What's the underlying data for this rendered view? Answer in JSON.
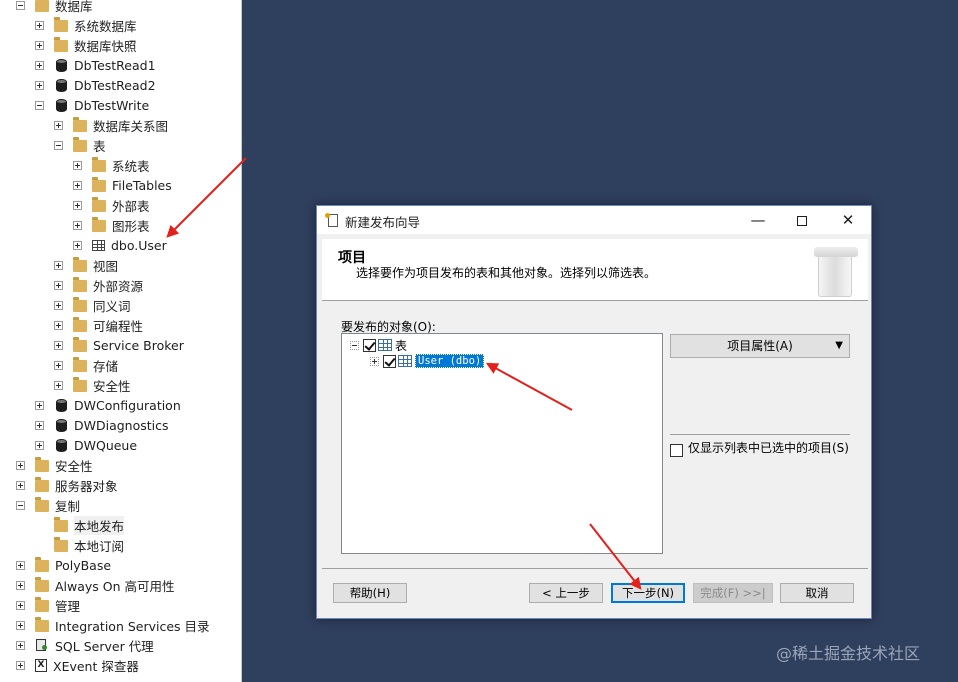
{
  "object_explorer": {
    "items": [
      {
        "label": "数据库",
        "icon": "folder-icon",
        "expander": "minus",
        "level": 0
      },
      {
        "label": "系统数据库",
        "icon": "folder-icon",
        "expander": "plus",
        "level": 1
      },
      {
        "label": "数据库快照",
        "icon": "folder-icon",
        "expander": "plus",
        "level": 1
      },
      {
        "label": "DbTestRead1",
        "icon": "database-icon",
        "expander": "plus",
        "level": 1
      },
      {
        "label": "DbTestRead2",
        "icon": "database-icon",
        "expander": "plus",
        "level": 1
      },
      {
        "label": "DbTestWrite",
        "icon": "database-icon",
        "expander": "minus",
        "level": 1
      },
      {
        "label": "数据库关系图",
        "icon": "folder-icon",
        "expander": "plus",
        "level": 2
      },
      {
        "label": "表",
        "icon": "folder-icon",
        "expander": "minus",
        "level": 2
      },
      {
        "label": "系统表",
        "icon": "folder-icon",
        "expander": "plus",
        "level": 3
      },
      {
        "label": "FileTables",
        "icon": "folder-icon",
        "expander": "plus",
        "level": 3
      },
      {
        "label": "外部表",
        "icon": "folder-icon",
        "expander": "plus",
        "level": 3
      },
      {
        "label": "图形表",
        "icon": "folder-icon",
        "expander": "plus",
        "level": 3
      },
      {
        "label": "dbo.User",
        "icon": "table-icon",
        "expander": "plus",
        "level": 3
      },
      {
        "label": "视图",
        "icon": "folder-icon",
        "expander": "plus",
        "level": 2
      },
      {
        "label": "外部资源",
        "icon": "folder-icon",
        "expander": "plus",
        "level": 2
      },
      {
        "label": "同义词",
        "icon": "folder-icon",
        "expander": "plus",
        "level": 2
      },
      {
        "label": "可编程性",
        "icon": "folder-icon",
        "expander": "plus",
        "level": 2
      },
      {
        "label": "Service Broker",
        "icon": "folder-icon",
        "expander": "plus",
        "level": 2
      },
      {
        "label": "存储",
        "icon": "folder-icon",
        "expander": "plus",
        "level": 2
      },
      {
        "label": "安全性",
        "icon": "folder-icon",
        "expander": "plus",
        "level": 2
      },
      {
        "label": "DWConfiguration",
        "icon": "database-icon",
        "expander": "plus",
        "level": 1
      },
      {
        "label": "DWDiagnostics",
        "icon": "database-icon",
        "expander": "plus",
        "level": 1
      },
      {
        "label": "DWQueue",
        "icon": "database-icon",
        "expander": "plus",
        "level": 1
      },
      {
        "label": "安全性",
        "icon": "folder-icon",
        "expander": "plus",
        "level": 0
      },
      {
        "label": "服务器对象",
        "icon": "folder-icon",
        "expander": "plus",
        "level": 0
      },
      {
        "label": "复制",
        "icon": "folder-icon",
        "expander": "minus",
        "level": 0
      },
      {
        "label": "本地发布",
        "icon": "folder-icon",
        "expander": "none",
        "level": 1,
        "selected": true
      },
      {
        "label": "本地订阅",
        "icon": "folder-icon",
        "expander": "none",
        "level": 1
      },
      {
        "label": "PolyBase",
        "icon": "folder-icon",
        "expander": "plus",
        "level": 0
      },
      {
        "label": "Always On 高可用性",
        "icon": "folder-icon",
        "expander": "plus",
        "level": 0
      },
      {
        "label": "管理",
        "icon": "folder-icon",
        "expander": "plus",
        "level": 0
      },
      {
        "label": "Integration Services 目录",
        "icon": "folder-icon",
        "expander": "plus",
        "level": 0
      },
      {
        "label": "SQL Server 代理",
        "icon": "agent-icon",
        "expander": "plus",
        "level": 0
      },
      {
        "label": "XEvent 探查器",
        "icon": "xevent-icon",
        "expander": "plus",
        "level": 0
      }
    ]
  },
  "dialog": {
    "title": "新建发布向导",
    "minimize_glyph": "—",
    "close_glyph": "✕",
    "header_title": "项目",
    "header_subtitle": "选择要作为项目发布的表和其他对象。选择列以筛选表。",
    "objects_label": "要发布的对象(O):",
    "objects_tree": [
      {
        "label": "表",
        "checked": true,
        "expander": "minus",
        "level": 0
      },
      {
        "label": "User (dbo)",
        "checked": true,
        "expander": "plus",
        "level": 1,
        "selected": true
      }
    ],
    "article_properties_button": "项目属性(A)",
    "dropdown_glyph": "▼",
    "only_show_checked_label": "仅显示列表中已选中的项目(S)",
    "only_show_checked": false,
    "buttons": {
      "help": "帮助(H)",
      "back": "< 上一步",
      "next": "下一步(N)",
      "finish": "完成(F) >>|",
      "cancel": "取消"
    }
  },
  "colors": {
    "background": "#2f3f5e",
    "arrow": "#e3201b",
    "selection": "#0078d7"
  },
  "watermark": "@稀土掘金技术社区"
}
